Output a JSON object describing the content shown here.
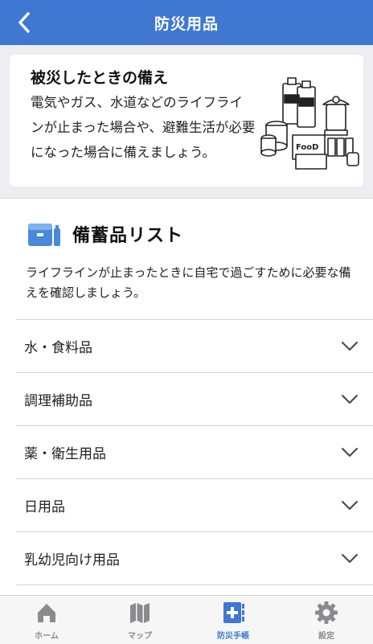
{
  "header": {
    "title": "防災用品",
    "back_icon": "chevron-left-icon"
  },
  "intro": {
    "title": "被災したときの備え",
    "text": "電気やガス、水道などのライフラインが止まった場合や、避難生活が必要になった場合に備えましょう。",
    "illustration_label": "FooD"
  },
  "supplies": {
    "title": "備蓄品リスト",
    "description": "ライフラインが止まったときに自宅で過ごすために必要な備えを確認しましょう。",
    "categories": [
      {
        "label": "水・食料品"
      },
      {
        "label": "調理補助品"
      },
      {
        "label": "薬・衛生用品"
      },
      {
        "label": "日用品"
      },
      {
        "label": "乳幼児向け用品"
      }
    ]
  },
  "tabs": [
    {
      "label": "ホーム",
      "icon": "home-icon"
    },
    {
      "label": "マップ",
      "icon": "map-icon"
    },
    {
      "label": "防災手帳",
      "icon": "handbook-icon",
      "active": true
    },
    {
      "label": "設定",
      "icon": "gear-icon"
    }
  ],
  "colors": {
    "accent": "#3f78d2",
    "background": "#ededf2",
    "inactive": "#8a8a8f"
  }
}
